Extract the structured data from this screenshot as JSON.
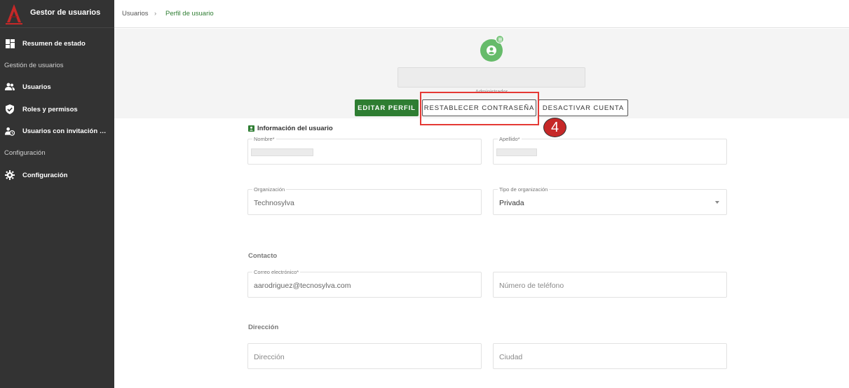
{
  "app": {
    "title": "Gestor de usuarios"
  },
  "sidebar": {
    "items": [
      {
        "label": "Resumen de estado",
        "icon": "dashboard-icon"
      },
      {
        "label": "Usuarios",
        "icon": "people-icon"
      },
      {
        "label": "Roles y permisos",
        "icon": "shield-check-icon"
      },
      {
        "label": "Usuarios con invitación pe...",
        "icon": "person-clock-icon"
      },
      {
        "label": "Configuración",
        "icon": "gear-icon"
      }
    ],
    "sections": [
      "Gestión de usuarios",
      "Configuración"
    ]
  },
  "breadcrumb": {
    "items": [
      "Usuarios",
      "Perfil de usuario"
    ],
    "separator": "›"
  },
  "profile": {
    "role": "Administrador",
    "buttons": {
      "edit": "EDITAR PERFIL",
      "reset": "RESTABLECER CONTRASEÑA",
      "deactivate": "DESACTIVAR CUENTA"
    },
    "step_marker": "4"
  },
  "form": {
    "user_info": {
      "title": "Información del usuario",
      "nombre_label": "Nombre*",
      "apellido_label": "Apellido*",
      "organizacion_label": "Organización",
      "organizacion_value": "Technosylva",
      "tipo_label": "Tipo de organización",
      "tipo_value": "Privada"
    },
    "contact": {
      "title": "Contacto",
      "email_label": "Correo electrónico*",
      "email_value": "aarodriguez@tecnosylva.com",
      "phone_placeholder": "Número de teléfono"
    },
    "address": {
      "title": "Dirección",
      "address_placeholder": "Dirección",
      "city_placeholder": "Ciudad"
    }
  },
  "colors": {
    "sidebar_bg": "#333333",
    "accent_green": "#2e7d32",
    "avatar_green": "#66bb6a",
    "highlight_red": "#e53935"
  }
}
